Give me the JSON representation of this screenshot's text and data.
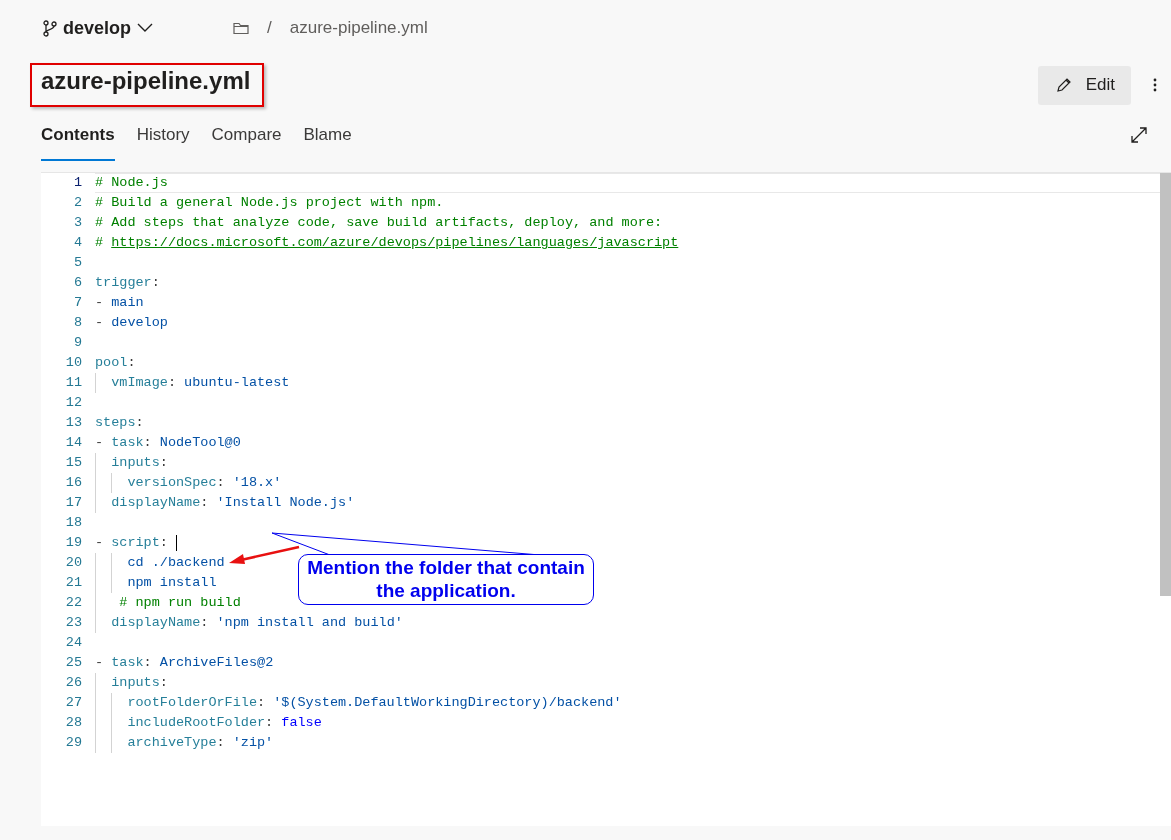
{
  "branch": {
    "name": "develop"
  },
  "breadcrumb": {
    "separator": "/",
    "file": "azure-pipeline.yml"
  },
  "title": "azure-pipeline.yml",
  "edit_button": "Edit",
  "tabs": [
    {
      "label": "Contents",
      "selected": true
    },
    {
      "label": "History",
      "selected": false
    },
    {
      "label": "Compare",
      "selected": false
    },
    {
      "label": "Blame",
      "selected": false
    }
  ],
  "code": {
    "lines": [
      {
        "number": "1",
        "current": true,
        "cursor": false,
        "tokens": [
          {
            "kind": "comment",
            "text": "# Node.js"
          }
        ]
      },
      {
        "number": "2",
        "current": false,
        "cursor": false,
        "tokens": [
          {
            "kind": "comment",
            "text": "# Build a general Node.js project with npm."
          }
        ]
      },
      {
        "number": "3",
        "current": false,
        "cursor": false,
        "tokens": [
          {
            "kind": "comment",
            "text": "# Add steps that analyze code, save build artifacts, deploy, and more:"
          }
        ]
      },
      {
        "number": "4",
        "current": false,
        "cursor": false,
        "tokens": [
          {
            "kind": "comment",
            "text": "# "
          },
          {
            "kind": "link",
            "text": "https://docs.microsoft.com/azure/devops/pipelines/languages/javascript"
          }
        ]
      },
      {
        "number": "5",
        "current": false,
        "cursor": false
      },
      {
        "number": "6",
        "current": false,
        "cursor": false,
        "tokens": [
          {
            "kind": "key",
            "text": "trigger"
          },
          {
            "kind": "punct",
            "text": ":"
          }
        ]
      },
      {
        "number": "7",
        "current": false,
        "cursor": false,
        "tokens": [
          {
            "kind": "punct",
            "text": "- "
          },
          {
            "kind": "value",
            "text": "main"
          }
        ]
      },
      {
        "number": "8",
        "current": false,
        "cursor": false,
        "tokens": [
          {
            "kind": "punct",
            "text": "- "
          },
          {
            "kind": "value",
            "text": "develop"
          }
        ]
      },
      {
        "number": "9",
        "current": false,
        "cursor": false
      },
      {
        "number": "10",
        "current": false,
        "cursor": false,
        "tokens": [
          {
            "kind": "key",
            "text": "pool"
          },
          {
            "kind": "punct",
            "text": ":"
          }
        ]
      },
      {
        "number": "11",
        "current": false,
        "cursor": false,
        "tokens": [
          {
            "kind": "key",
            "text": "  vmImage"
          },
          {
            "kind": "punct",
            "text": ": "
          },
          {
            "kind": "value",
            "text": "ubuntu-latest"
          }
        ]
      },
      {
        "number": "12",
        "current": false,
        "cursor": false
      },
      {
        "number": "13",
        "current": false,
        "cursor": false,
        "tokens": [
          {
            "kind": "key",
            "text": "steps"
          },
          {
            "kind": "punct",
            "text": ":"
          }
        ]
      },
      {
        "number": "14",
        "current": false,
        "cursor": false,
        "tokens": [
          {
            "kind": "punct",
            "text": "- "
          },
          {
            "kind": "key",
            "text": "task"
          },
          {
            "kind": "punct",
            "text": ": "
          },
          {
            "kind": "value",
            "text": "NodeTool@0"
          }
        ]
      },
      {
        "number": "15",
        "current": false,
        "cursor": false,
        "tokens": [
          {
            "kind": "key",
            "text": "  inputs"
          },
          {
            "kind": "punct",
            "text": ":"
          }
        ]
      },
      {
        "number": "16",
        "current": false,
        "cursor": false,
        "tokens": [
          {
            "kind": "key",
            "text": "    versionSpec"
          },
          {
            "kind": "punct",
            "text": ": "
          },
          {
            "kind": "value",
            "text": "'18.x'"
          }
        ]
      },
      {
        "number": "17",
        "current": false,
        "cursor": false,
        "tokens": [
          {
            "kind": "key",
            "text": "  displayName"
          },
          {
            "kind": "punct",
            "text": ": "
          },
          {
            "kind": "value",
            "text": "'Install Node.js'"
          }
        ]
      },
      {
        "number": "18",
        "current": false,
        "cursor": false
      },
      {
        "number": "19",
        "current": false,
        "cursor": true,
        "tokens": [
          {
            "kind": "punct",
            "text": "- "
          },
          {
            "kind": "key",
            "text": "script"
          },
          {
            "kind": "punct",
            "text": ": "
          }
        ]
      },
      {
        "number": "20",
        "current": false,
        "cursor": false,
        "tokens": [
          {
            "kind": "value",
            "text": "    cd ./backend"
          }
        ]
      },
      {
        "number": "21",
        "current": false,
        "cursor": false,
        "tokens": [
          {
            "kind": "value",
            "text": "    npm install"
          }
        ]
      },
      {
        "number": "22",
        "current": false,
        "cursor": false,
        "tokens": [
          {
            "kind": "comment",
            "text": "   # npm run build"
          }
        ]
      },
      {
        "number": "23",
        "current": false,
        "cursor": false,
        "tokens": [
          {
            "kind": "key",
            "text": "  displayName"
          },
          {
            "kind": "punct",
            "text": ": "
          },
          {
            "kind": "value",
            "text": "'npm install and build'"
          }
        ]
      },
      {
        "number": "24",
        "current": false,
        "cursor": false
      },
      {
        "number": "25",
        "current": false,
        "cursor": false,
        "tokens": [
          {
            "kind": "punct",
            "text": "- "
          },
          {
            "kind": "key",
            "text": "task"
          },
          {
            "kind": "punct",
            "text": ": "
          },
          {
            "kind": "value",
            "text": "ArchiveFiles@2"
          }
        ]
      },
      {
        "number": "26",
        "current": false,
        "cursor": false,
        "tokens": [
          {
            "kind": "key",
            "text": "  inputs"
          },
          {
            "kind": "punct",
            "text": ":"
          }
        ]
      },
      {
        "number": "27",
        "current": false,
        "cursor": false,
        "tokens": [
          {
            "kind": "key",
            "text": "    rootFolderOrFile"
          },
          {
            "kind": "punct",
            "text": ": "
          },
          {
            "kind": "value",
            "text": "'$(System.DefaultWorkingDirectory)/backend'"
          }
        ]
      },
      {
        "number": "28",
        "current": false,
        "cursor": false,
        "tokens": [
          {
            "kind": "key",
            "text": "    includeRootFolder"
          },
          {
            "kind": "punct",
            "text": ": "
          },
          {
            "kind": "bool",
            "text": "false"
          }
        ]
      },
      {
        "number": "29",
        "current": false,
        "cursor": false,
        "tokens": [
          {
            "kind": "key",
            "text": "    archiveType"
          },
          {
            "kind": "punct",
            "text": ": "
          },
          {
            "kind": "value",
            "text": "'zip'"
          }
        ]
      }
    ]
  },
  "annotation": {
    "text": "Mention the folder that contain the application."
  }
}
